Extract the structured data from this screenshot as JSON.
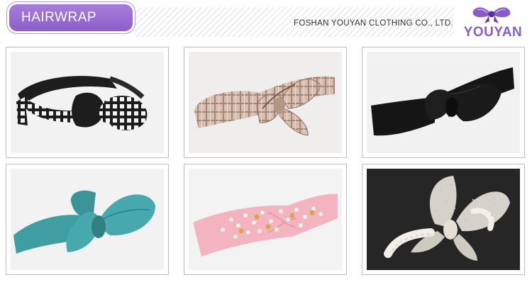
{
  "header": {
    "category_label": "HAIRWRAP",
    "company_name": "FOSHAN YOUYAN CLOTHING CO., LTD.",
    "logo_text": "YOUYAN"
  },
  "colors": {
    "brand_purple": "#8a5cc8",
    "tile_border": "#bdbdbd"
  },
  "products": [
    {
      "name": "black-plaid-bow-headband",
      "fabric": "#1d1d1d",
      "accent": "#f1f1f1",
      "pattern": "plaid",
      "background": "#f2f2f2"
    },
    {
      "name": "beige-plaid-bow-headband",
      "fabric": "#cdb3a3",
      "accent": "#9a7b68",
      "pattern": "plaid",
      "background": "#efeeec"
    },
    {
      "name": "black-bow-headband",
      "fabric": "#151515",
      "accent": "#2a2a2a",
      "pattern": "solid",
      "background": "#f1f1f1"
    },
    {
      "name": "teal-bow-headband",
      "fabric": "#3f9ea2",
      "accent": "#2f7f83",
      "pattern": "solid",
      "background": "#f2f2f2"
    },
    {
      "name": "pink-pearl-headband",
      "fabric": "#f3b3bf",
      "accent": "#e89aa8",
      "pattern": "pearls",
      "background": "#f3f3f3"
    },
    {
      "name": "white-tulle-bow-headband",
      "fabric": "#f1efe6",
      "accent": "#d8d4c6",
      "pattern": "tulle",
      "background": "#262626"
    }
  ]
}
